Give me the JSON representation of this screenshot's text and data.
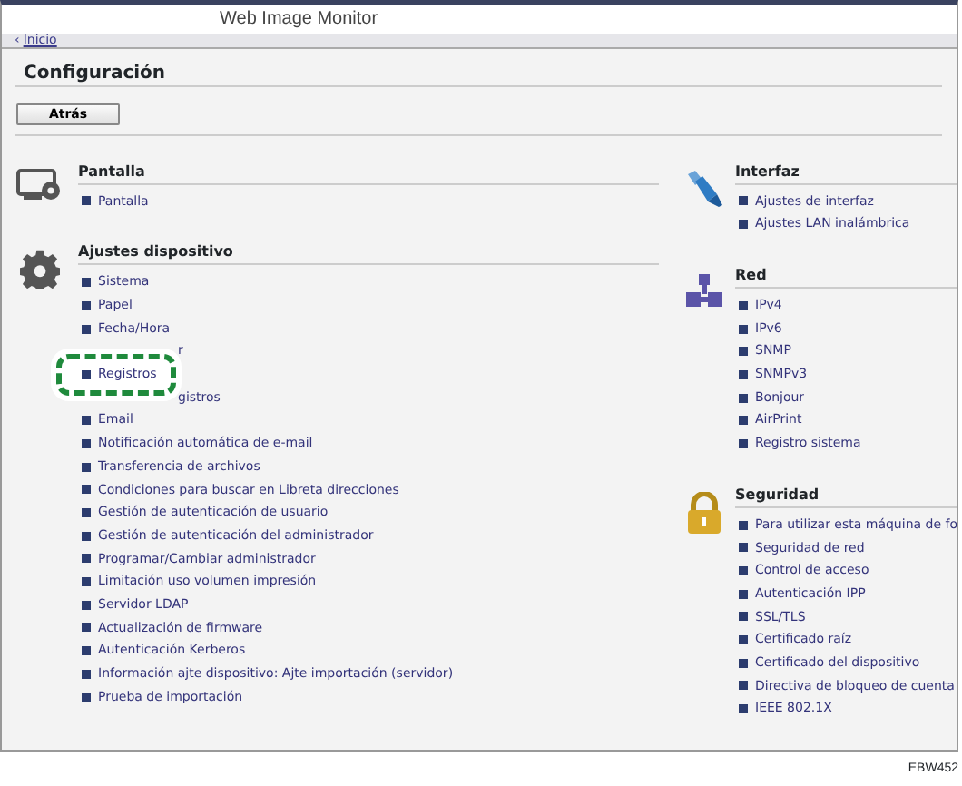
{
  "header": {
    "title": "Web Image Monitor"
  },
  "breadcrumb": {
    "arrow": "‹",
    "label": "Inicio"
  },
  "page_title": "Configuración",
  "back_button": "Atrás",
  "columns": [
    [
      {
        "title": "Pantalla",
        "items": [
          {
            "text": "Pantalla",
            "kind": "link",
            "highlighted": false
          }
        ]
      },
      {
        "title": "Ajustes dispositivo",
        "items": [
          {
            "text": "Sistema",
            "kind": "link",
            "highlighted": false
          },
          {
            "text": "Papel",
            "kind": "link",
            "highlighted": false
          },
          {
            "text": "Fecha/Hora",
            "kind": "link",
            "highlighted": false
          },
          {
            "text": "r",
            "kind": "partial",
            "highlighted": false
          },
          {
            "text": "Registros",
            "kind": "link",
            "highlighted": true
          },
          {
            "text": "gistros",
            "kind": "partial",
            "highlighted": false
          },
          {
            "text": "Email",
            "kind": "link",
            "highlighted": false
          },
          {
            "text": "Notificación automática de e-mail",
            "kind": "link",
            "highlighted": false
          },
          {
            "text": "Transferencia de archivos",
            "kind": "link",
            "highlighted": false
          },
          {
            "text": "Condiciones para buscar en Libreta direcciones",
            "kind": "link",
            "highlighted": false
          },
          {
            "text": "Gestión de autenticación de usuario",
            "kind": "link",
            "highlighted": false
          },
          {
            "text": "Gestión de autenticación del administrador",
            "kind": "link",
            "highlighted": false
          },
          {
            "text": "Programar/Cambiar administrador",
            "kind": "link",
            "highlighted": false
          },
          {
            "text": "Limitación uso volumen impresión",
            "kind": "link",
            "highlighted": false
          },
          {
            "text": "Servidor LDAP",
            "kind": "link",
            "highlighted": false
          },
          {
            "text": "Actualización de firmware",
            "kind": "link",
            "highlighted": false
          },
          {
            "text": "Autenticación Kerberos",
            "kind": "link",
            "highlighted": false
          },
          {
            "text": "Información ajte dispositivo: Ajte importación (servidor)",
            "kind": "link",
            "highlighted": false
          },
          {
            "text": "Prueba de importación",
            "kind": "link",
            "highlighted": false
          }
        ]
      }
    ],
    [
      {
        "title": "Interfaz",
        "items": [
          {
            "text": "Ajustes de interfaz",
            "kind": "link",
            "highlighted": false
          },
          {
            "text": "Ajustes LAN inalámbrica",
            "kind": "link",
            "highlighted": false
          }
        ]
      },
      {
        "title": "Red",
        "items": [
          {
            "text": "IPv4",
            "kind": "link",
            "highlighted": false
          },
          {
            "text": "IPv6",
            "kind": "link",
            "highlighted": false
          },
          {
            "text": "SNMP",
            "kind": "link",
            "highlighted": false
          },
          {
            "text": "SNMPv3",
            "kind": "link",
            "highlighted": false
          },
          {
            "text": "Bonjour",
            "kind": "link",
            "highlighted": false
          },
          {
            "text": "AirPrint",
            "kind": "link",
            "highlighted": false
          },
          {
            "text": "Registro sistema",
            "kind": "link",
            "highlighted": false
          }
        ]
      },
      {
        "title": "Seguridad",
        "items": [
          {
            "text": "Para utilizar esta máquina de fo",
            "kind": "link",
            "highlighted": false
          },
          {
            "text": "Seguridad de red",
            "kind": "link",
            "highlighted": false
          },
          {
            "text": "Control de acceso",
            "kind": "link",
            "highlighted": false
          },
          {
            "text": "Autenticación IPP",
            "kind": "link",
            "highlighted": false
          },
          {
            "text": "SSL/TLS",
            "kind": "link",
            "highlighted": false
          },
          {
            "text": "Certificado raíz",
            "kind": "link",
            "highlighted": false
          },
          {
            "text": "Certificado del dispositivo",
            "kind": "link",
            "highlighted": false
          },
          {
            "text": "Directiva de bloqueo de cuenta",
            "kind": "link",
            "highlighted": false
          },
          {
            "text": "IEEE 802.1X",
            "kind": "link",
            "highlighted": false
          }
        ]
      }
    ]
  ],
  "figure_code": "EBW452"
}
